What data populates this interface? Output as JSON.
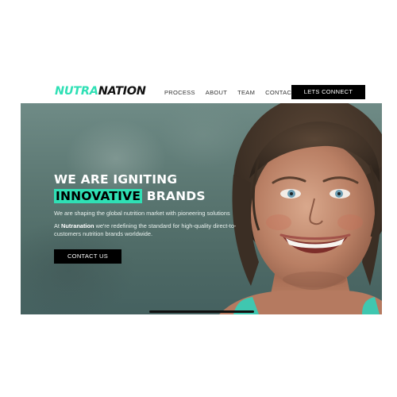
{
  "brand": {
    "logo_part1": "NUTRA",
    "logo_part2": "NATION",
    "accent_color": "#2fe0b5"
  },
  "nav": {
    "items": [
      {
        "label": "PROCESS"
      },
      {
        "label": "ABOUT"
      },
      {
        "label": "TEAM"
      },
      {
        "label": "CONTACT"
      }
    ],
    "cta_label": "LETS CONNECT"
  },
  "hero": {
    "headline_line1": "WE ARE IGNITING",
    "headline_highlight": "INNOVATIVE",
    "headline_rest": " BRANDS",
    "subtitle": "We are shaping the global nutrition market with pioneering solutions",
    "body_prefix": "At ",
    "body_brand": "Nutranation",
    "body_text": " we're redefining the standard for high-quality direct-to-customers nutrition brands worldwide.",
    "cta_label": "CONTACT US"
  }
}
